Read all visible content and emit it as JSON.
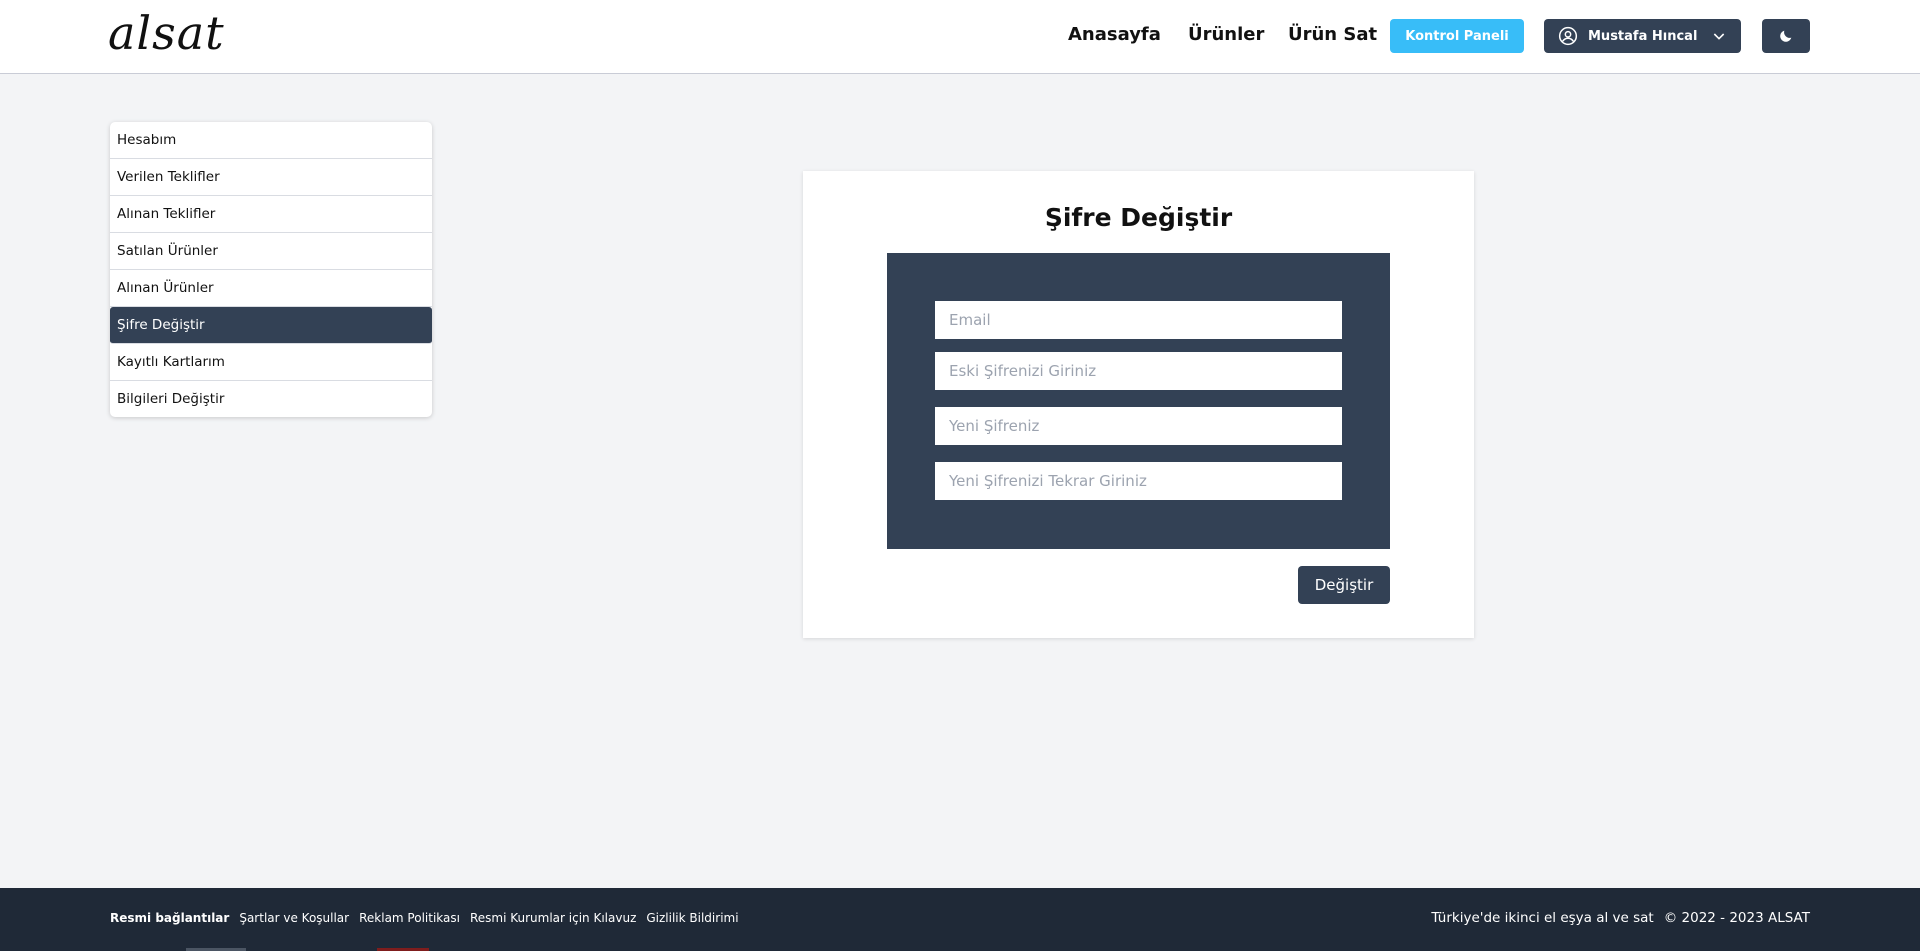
{
  "header": {
    "logo": "alsat",
    "nav": {
      "home": "Anasayfa",
      "products": "Ürünler",
      "sell": "Ürün Sat"
    },
    "panel_button": "Kontrol Paneli",
    "user_button": "Mustafa Hıncal",
    "icons": {
      "user": "user-circle-icon",
      "chevron": "chevron-down-icon",
      "theme": "moon-icon"
    }
  },
  "sidebar": {
    "items": [
      {
        "label": "Hesabım",
        "active": false
      },
      {
        "label": "Verilen Teklifler",
        "active": false
      },
      {
        "label": "Alınan Teklifler",
        "active": false
      },
      {
        "label": "Satılan Ürünler",
        "active": false
      },
      {
        "label": "Alınan Ürünler",
        "active": false
      },
      {
        "label": "Şifre Değiştir",
        "active": true
      },
      {
        "label": "Kayıtlı Kartlarım",
        "active": false
      },
      {
        "label": "Bilgileri Değiştir",
        "active": false
      }
    ]
  },
  "form": {
    "title": "Şifre Değiştir",
    "email": {
      "value": "",
      "placeholder": "Email"
    },
    "old_password": {
      "value": "",
      "placeholder": "Eski Şifrenizi Giriniz"
    },
    "new_password": {
      "value": "",
      "placeholder": "Yeni Şifreniz"
    },
    "repeat_password": {
      "value": "",
      "placeholder": "Yeni Şifrenizi Tekrar Giriniz"
    },
    "submit": "Değiştir"
  },
  "footer": {
    "links_title": "Resmi bağlantılar",
    "links": [
      "Şartlar ve Koşullar",
      "Reklam Politikası",
      "Resmi Kurumlar için Kılavuz",
      "Gizlilik Bildirimi"
    ],
    "tagline": "Türkiye'de ikinci el eşya al ve sat",
    "copyright": "© 2022 - 2023 ALSAT"
  },
  "colors": {
    "accent": "#38bdf8",
    "primary": "#334155",
    "footer": "#1f2937",
    "background": "#f3f4f6"
  }
}
